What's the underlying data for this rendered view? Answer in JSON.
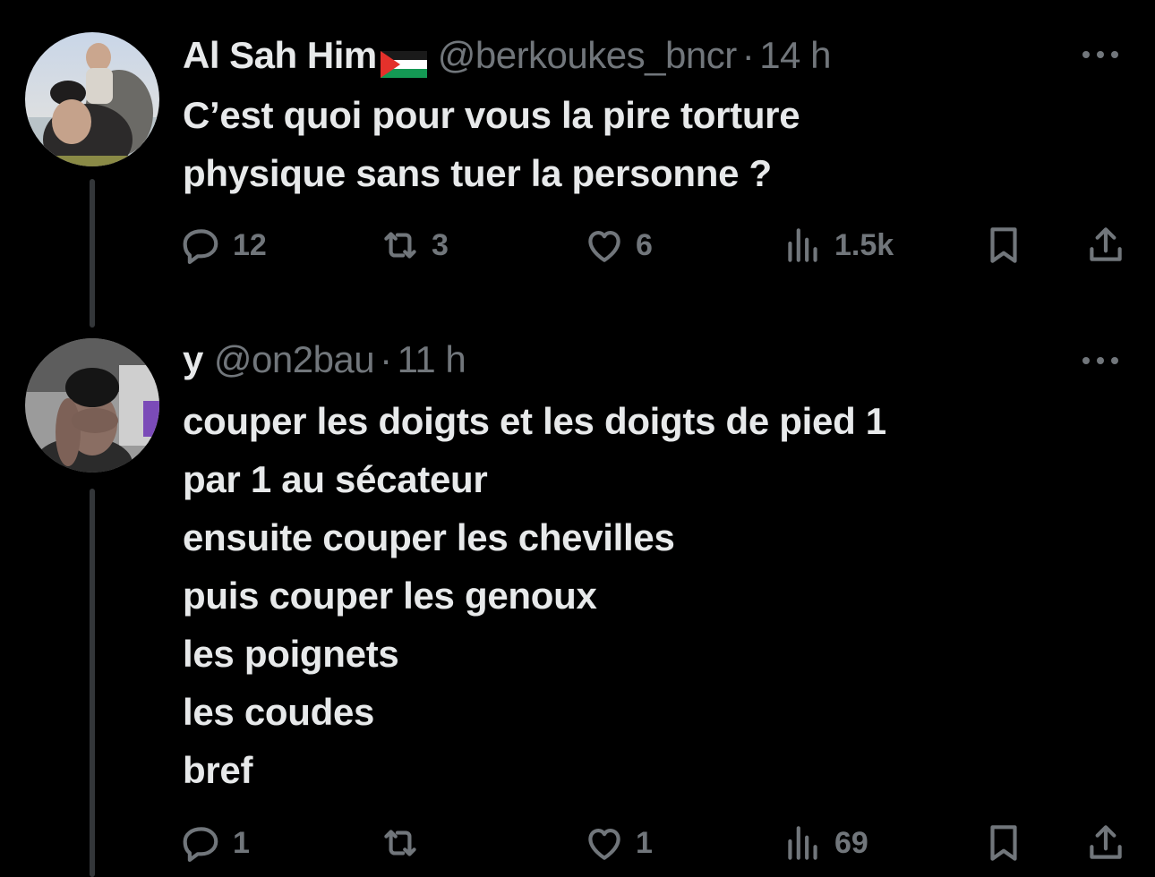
{
  "tweets": [
    {
      "display_name": "Al Sah Him",
      "handle": "@berkoukes_bncr",
      "separator": "·",
      "time": "14 h",
      "body_lines": [
        "C’est quoi pour vous la pire torture",
        "physique sans tuer la personne ?"
      ],
      "replies": "12",
      "reposts": "3",
      "likes": "6",
      "views": "1.5k"
    },
    {
      "display_name": "y",
      "handle": "@on2bau",
      "separator": "·",
      "time": "11 h",
      "body_lines": [
        "couper les doigts et les doigts de pied 1",
        "par 1 au sécateur",
        "ensuite couper les chevilles",
        "puis couper les genoux",
        "les poignets",
        "les coudes",
        "bref"
      ],
      "replies": "1",
      "reposts": "",
      "likes": "1",
      "views": "69"
    }
  ],
  "icons": {
    "reply": "reply-icon",
    "repost": "repost-icon",
    "like": "heart-icon",
    "views": "views-icon",
    "bookmark": "bookmark-icon",
    "share": "share-icon",
    "more": "more-icon",
    "flag": "palestine-flag-icon"
  },
  "colors": {
    "background": "#000000",
    "text_primary": "#e7e9ea",
    "text_secondary": "#71767b",
    "thread_line": "#333639"
  }
}
